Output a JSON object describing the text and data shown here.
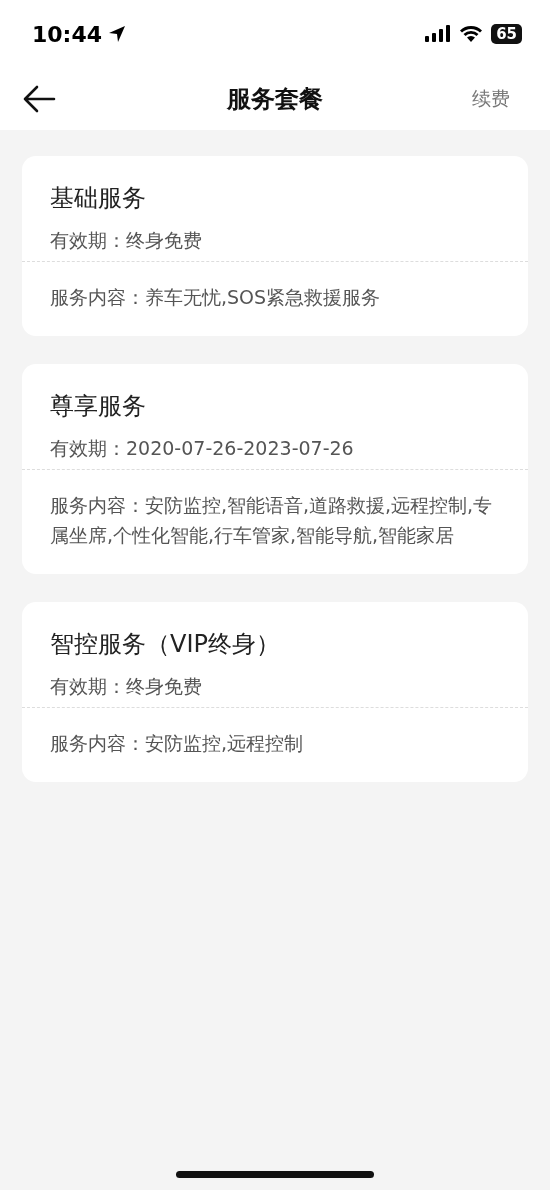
{
  "status_bar": {
    "time": "10:44",
    "battery": "65"
  },
  "nav_bar": {
    "title": "服务套餐",
    "action": "续费"
  },
  "packages": [
    {
      "name": "基础服务",
      "validity": "有效期：终身免费",
      "content": "服务内容：养车无忧,SOS紧急救援服务"
    },
    {
      "name": "尊享服务",
      "validity": "有效期：2020-07-26-2023-07-26",
      "content": "服务内容：安防监控,智能语音,道路救援,远程控制,专属坐席,个性化智能,行车管家,智能导航,智能家居"
    },
    {
      "name": "智控服务（VIP终身）",
      "validity": "有效期：终身免费",
      "content": "服务内容：安防监控,远程控制"
    }
  ]
}
